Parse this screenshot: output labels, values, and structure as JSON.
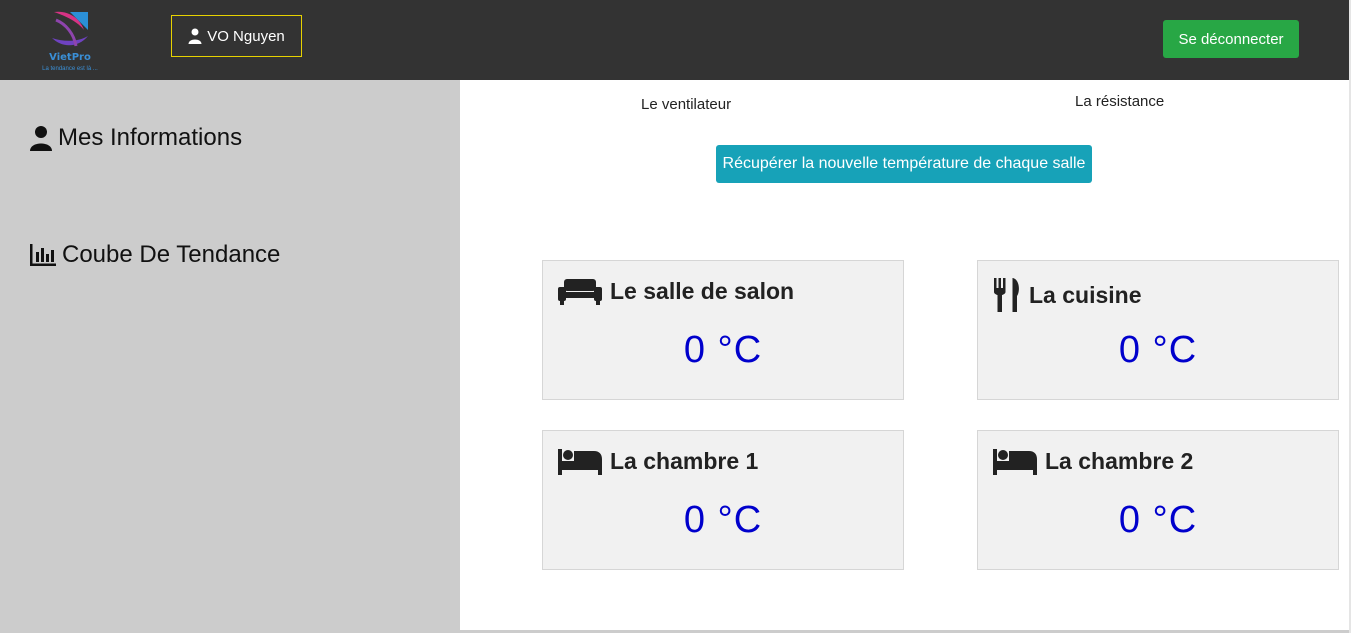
{
  "header": {
    "logo_name": "VietPro",
    "logo_tagline": "La tendance est là ..."
  },
  "user": {
    "name": "VO Nguyen"
  },
  "logout": {
    "label": "Se déconnecter"
  },
  "sidebar": {
    "items": [
      {
        "label": "Mes Informations",
        "icon": "user-icon"
      },
      {
        "label": "Coube De Tendance",
        "icon": "chart-bar-icon"
      }
    ]
  },
  "controls": {
    "fan_label": "Le ventilateur",
    "heater_label": "La résistance",
    "fetch_button": "Récupérer la nouvelle température de chaque salle"
  },
  "rooms": [
    {
      "name": "Le salle de salon",
      "temp": "0 °C",
      "icon": "couch-icon"
    },
    {
      "name": "La cuisine",
      "temp": "0 °C",
      "icon": "utensils-icon"
    },
    {
      "name": "La chambre 1",
      "temp": "0 °C",
      "icon": "bed-icon"
    },
    {
      "name": "La chambre 2",
      "temp": "0 °C",
      "icon": "bed-icon"
    }
  ],
  "colors": {
    "topbar": "#333333",
    "sidebar": "#cccccc",
    "logout": "#28a745",
    "fetch": "#17a2b8",
    "temperature": "#0000cc",
    "user_border": "#e6d200"
  }
}
